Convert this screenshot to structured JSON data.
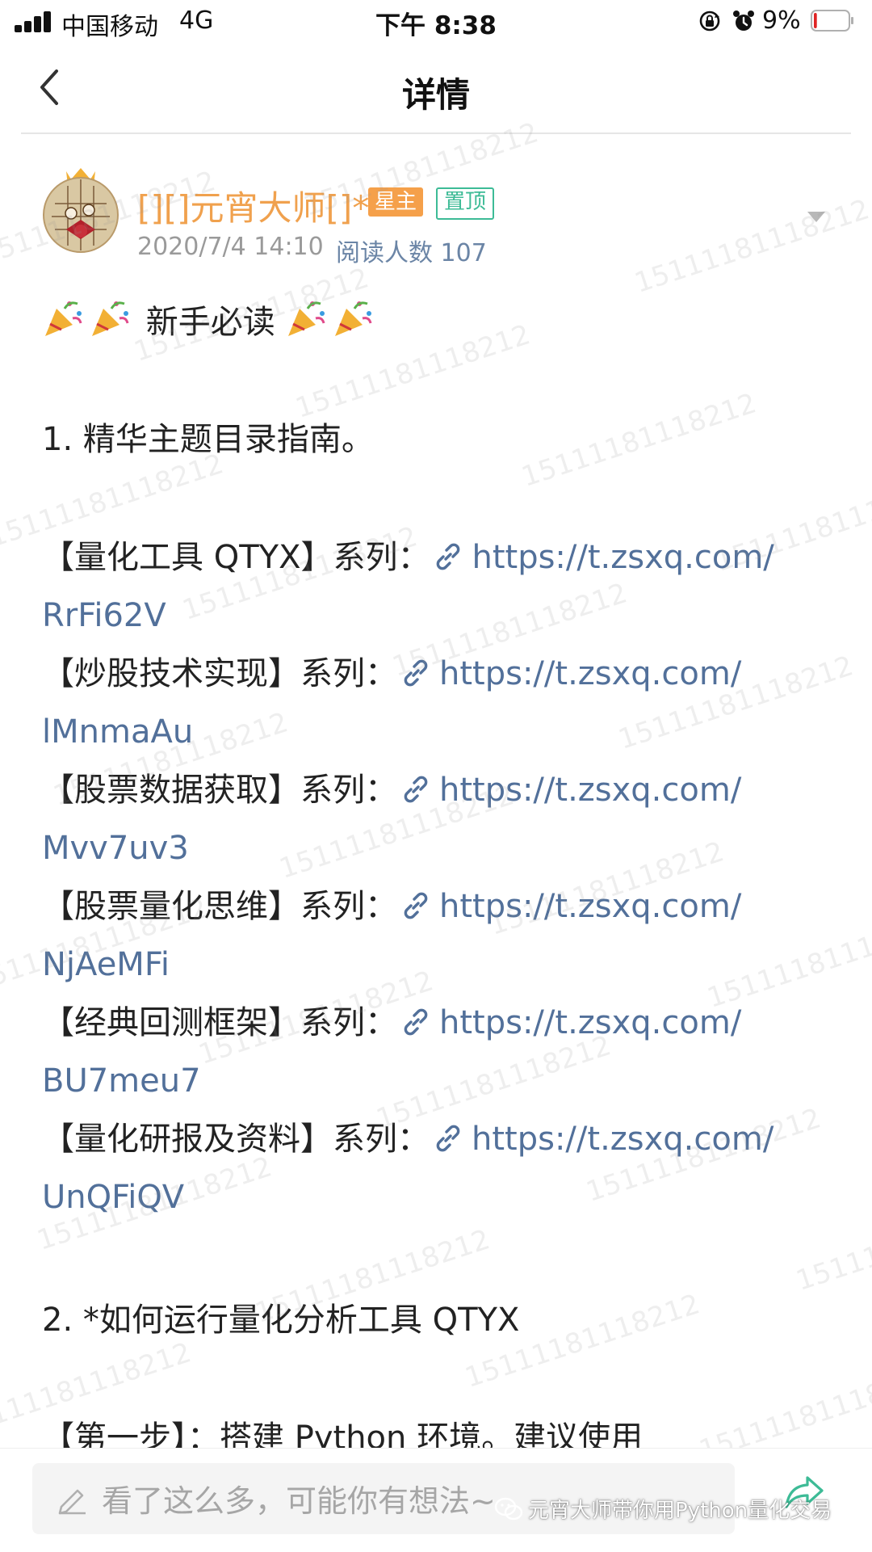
{
  "status_bar": {
    "carrier": "中国移动",
    "network": "4G",
    "time": "下午 8:38",
    "battery_percent": "9%",
    "battery_level": 0.09
  },
  "nav": {
    "title": "详情"
  },
  "post": {
    "author_name": "[][]元宵大师[]*",
    "badge_star": "星主",
    "badge_pin": "置顶",
    "date": "2020/7/4 14:10",
    "read_count": "阅读人数 107"
  },
  "article": {
    "heading": "新手必读",
    "section1_title": "1. 精华主题目录指南。",
    "series": [
      {
        "label": "【量化工具 QTYX】系列：",
        "url_part1": "https://t.zsxq.com/",
        "url_part2": "RrFi62V"
      },
      {
        "label": "【炒股技术实现】系列：",
        "url_part1": "https://t.zsxq.com/",
        "url_part2": "lMnmaAu"
      },
      {
        "label": "【股票数据获取】系列：",
        "url_part1": "https://t.zsxq.com/",
        "url_part2": "Mvv7uv3"
      },
      {
        "label": "【股票量化思维】系列：",
        "url_part1": "https://t.zsxq.com/",
        "url_part2": "NjAeMFi"
      },
      {
        "label": "【经典回测框架】系列：",
        "url_part1": "https://t.zsxq.com/",
        "url_part2": "BU7meu7"
      },
      {
        "label": "【量化研报及资料】系列：",
        "url_part1": "https://t.zsxq.com/",
        "url_part2": "UnQFiQV"
      }
    ],
    "section2_title": "2. *如何运行量化分析工具 QTYX",
    "step1_text": "【第一步】：搭建 Python 环境。建议使用"
  },
  "comment_bar": {
    "placeholder": "看了这么多，可能你有想法~",
    "wechat_tag": "元宵大师带你用Python量化交易"
  },
  "watermark": {
    "text": "15111181118212"
  },
  "colors": {
    "author": "#f0a14e",
    "badge_star": "#f5a04a",
    "badge_pin": "#3dbb96",
    "link": "#52709a",
    "meta": "#9a9a9a"
  },
  "icons": [
    "signal-icon",
    "back-arrow-icon",
    "rotation-lock-icon",
    "alarm-icon",
    "battery-icon",
    "party-popper-icon",
    "link-icon",
    "pencil-icon",
    "share-icon",
    "wechat-icon",
    "more-caret-icon"
  ]
}
